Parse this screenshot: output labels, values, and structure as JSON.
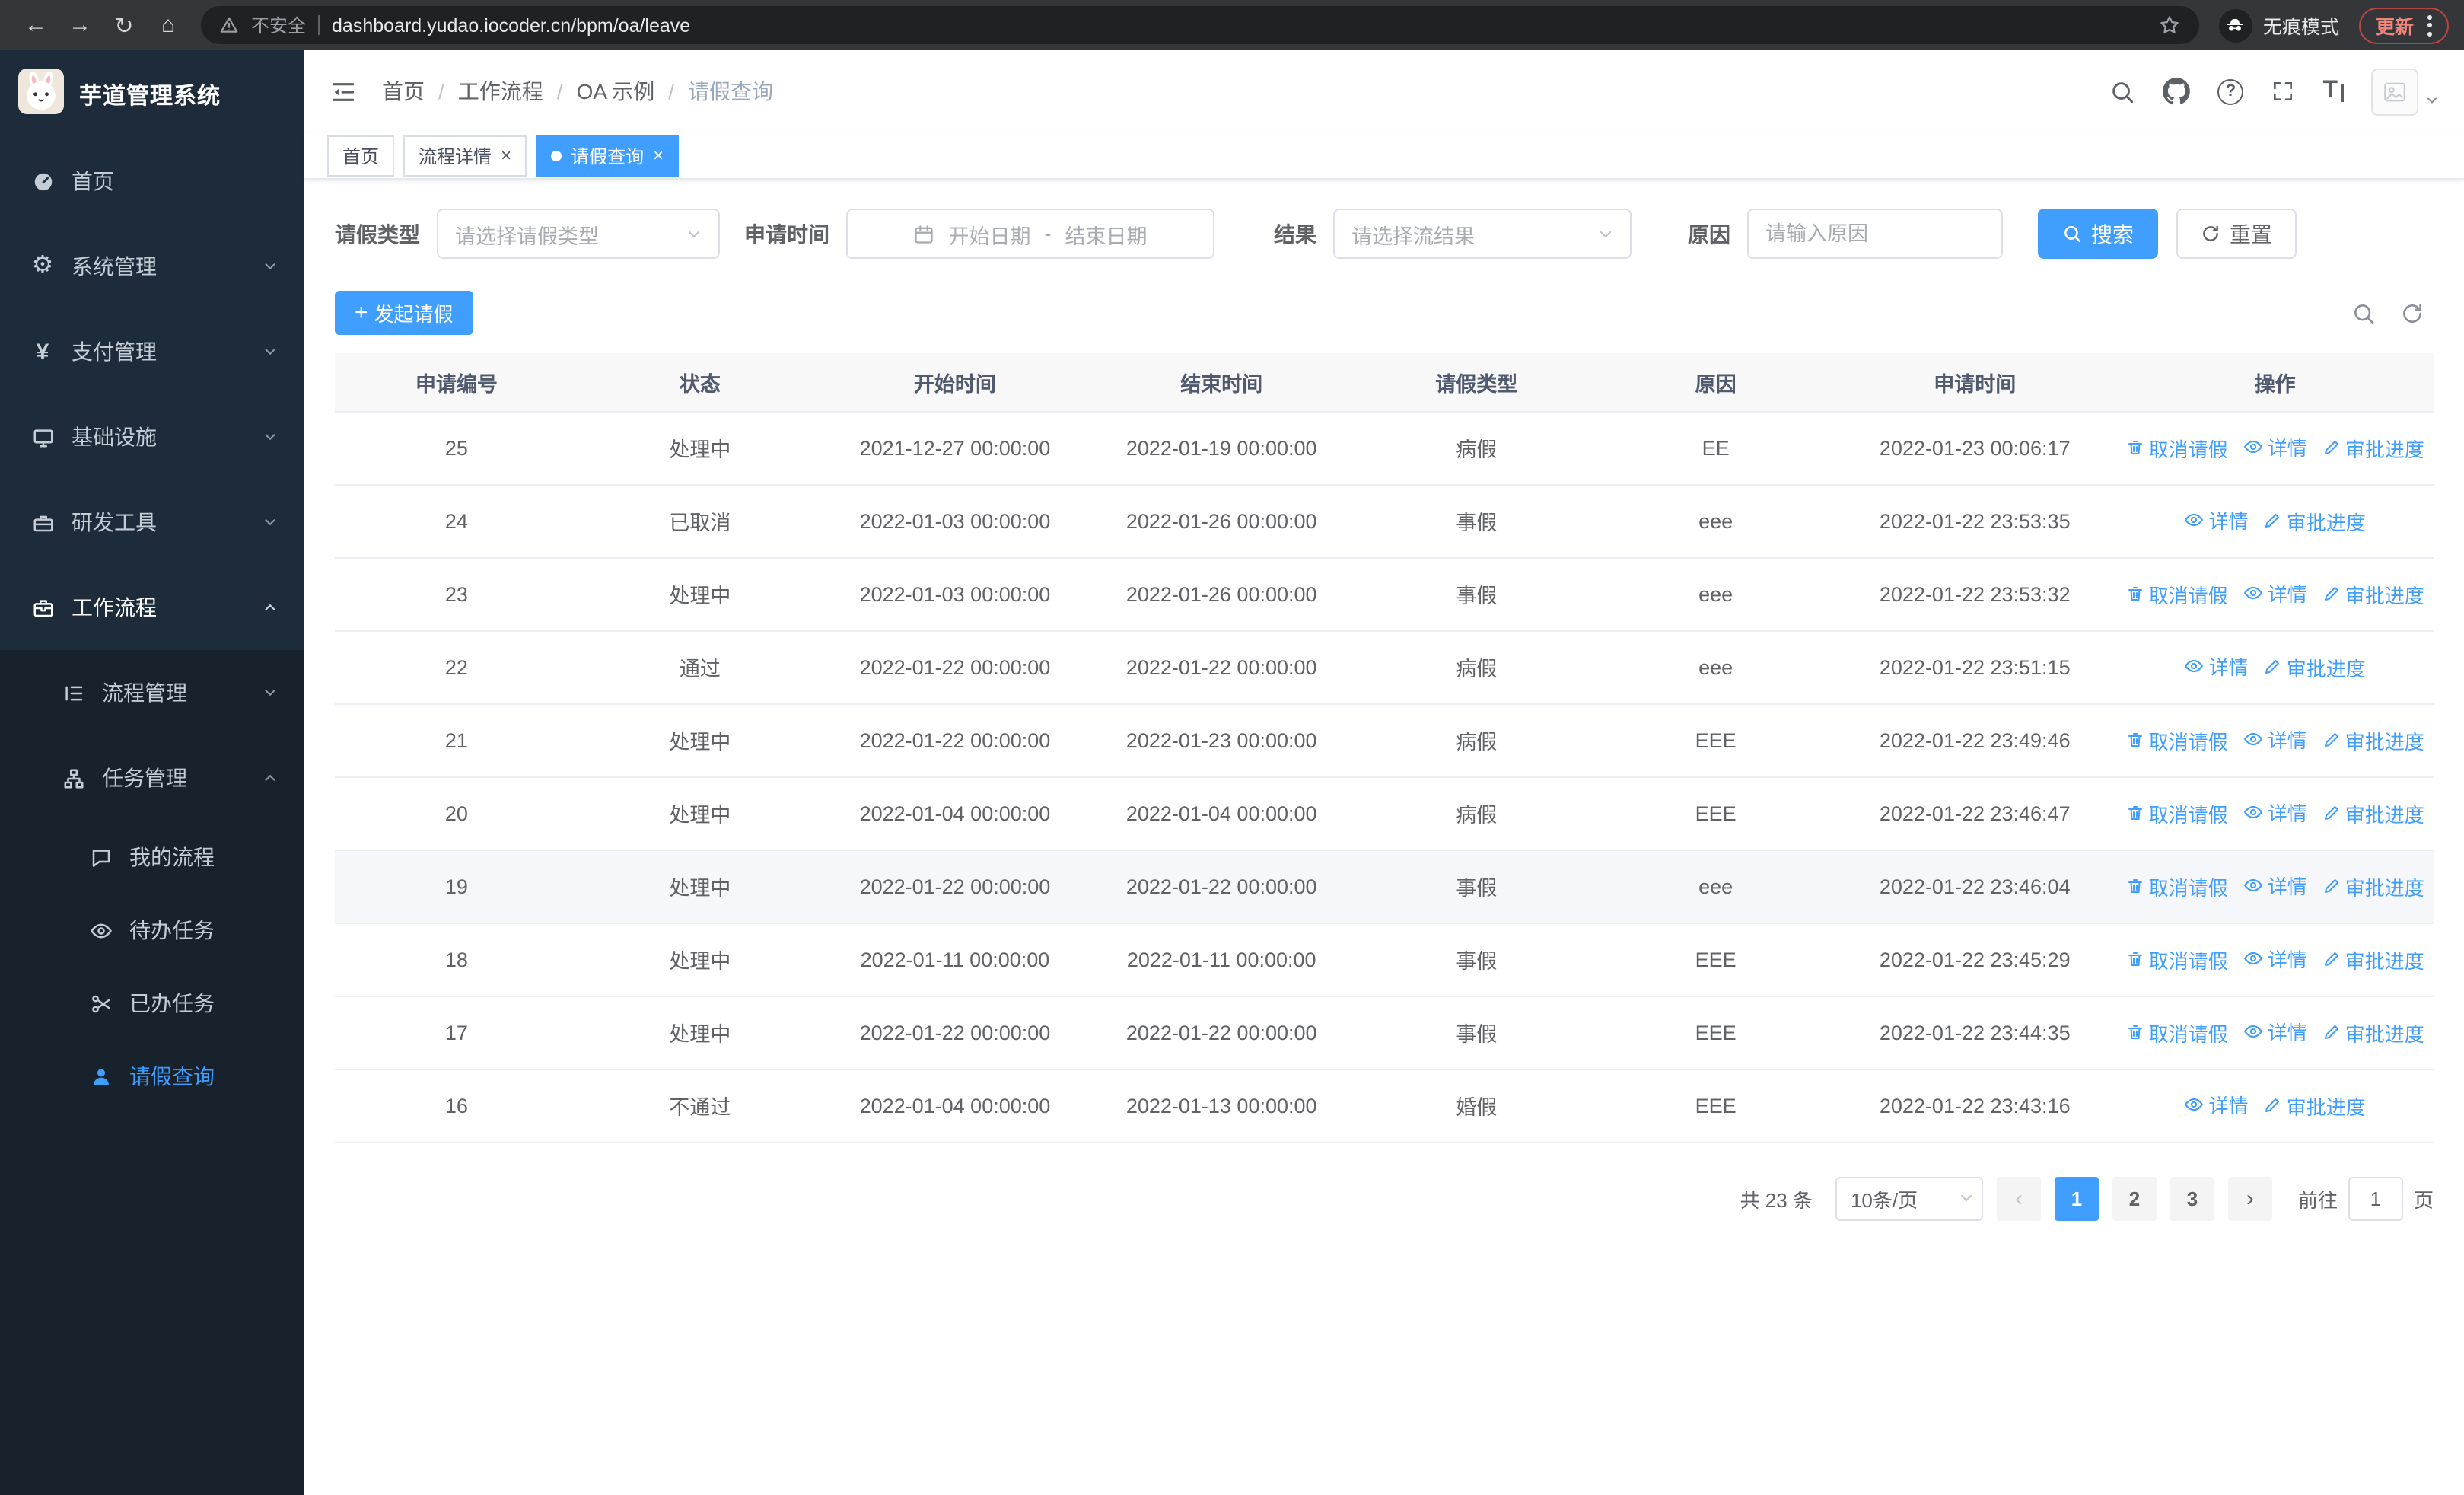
{
  "browser": {
    "security_label": "不安全",
    "url": "dashboard.yudao.iocoder.cn/bpm/oa/leave",
    "incognito_label": "无痕模式",
    "update_label": "更新"
  },
  "sidebar": {
    "logo_title": "芋道管理系统",
    "menu": [
      {
        "label": "首页"
      },
      {
        "label": "系统管理"
      },
      {
        "label": "支付管理"
      },
      {
        "label": "基础设施"
      },
      {
        "label": "研发工具"
      },
      {
        "label": "工作流程"
      }
    ],
    "submenu": [
      {
        "label": "流程管理"
      },
      {
        "label": "任务管理"
      }
    ],
    "leaf_items": [
      {
        "label": "我的流程"
      },
      {
        "label": "待办任务"
      },
      {
        "label": "已办任务"
      },
      {
        "label": "请假查询"
      }
    ]
  },
  "breadcrumb": [
    "首页",
    "工作流程",
    "OA 示例",
    "请假查询"
  ],
  "tabs": [
    {
      "label": "首页",
      "closable": false,
      "active": false
    },
    {
      "label": "流程详情",
      "closable": true,
      "active": false
    },
    {
      "label": "请假查询",
      "closable": true,
      "active": true
    }
  ],
  "filters": {
    "leave_type_label": "请假类型",
    "leave_type_placeholder": "请选择请假类型",
    "apply_time_label": "申请时间",
    "start_date_placeholder": "开始日期",
    "range_separator": "-",
    "end_date_placeholder": "结束日期",
    "result_label": "结果",
    "result_placeholder": "请选择流结果",
    "reason_label": "原因",
    "reason_placeholder": "请输入原因",
    "search_button": "搜索",
    "reset_button": "重置"
  },
  "toolbar": {
    "create_button": "发起请假"
  },
  "table": {
    "columns": [
      "申请编号",
      "状态",
      "开始时间",
      "结束时间",
      "请假类型",
      "原因",
      "申请时间",
      "操作"
    ],
    "action_labels": {
      "cancel": "取消请假",
      "detail": "详情",
      "progress": "审批进度"
    },
    "rows": [
      {
        "id": "25",
        "status": "处理中",
        "start": "2021-12-27 00:00:00",
        "end": "2022-01-19 00:00:00",
        "type": "病假",
        "reason": "EE",
        "apply_time": "2022-01-23 00:06:17",
        "actions": [
          "cancel",
          "detail",
          "progress"
        ]
      },
      {
        "id": "24",
        "status": "已取消",
        "start": "2022-01-03 00:00:00",
        "end": "2022-01-26 00:00:00",
        "type": "事假",
        "reason": "eee",
        "apply_time": "2022-01-22 23:53:35",
        "actions": [
          "detail",
          "progress"
        ]
      },
      {
        "id": "23",
        "status": "处理中",
        "start": "2022-01-03 00:00:00",
        "end": "2022-01-26 00:00:00",
        "type": "事假",
        "reason": "eee",
        "apply_time": "2022-01-22 23:53:32",
        "actions": [
          "cancel",
          "detail",
          "progress"
        ]
      },
      {
        "id": "22",
        "status": "通过",
        "start": "2022-01-22 00:00:00",
        "end": "2022-01-22 00:00:00",
        "type": "病假",
        "reason": "eee",
        "apply_time": "2022-01-22 23:51:15",
        "actions": [
          "detail",
          "progress"
        ]
      },
      {
        "id": "21",
        "status": "处理中",
        "start": "2022-01-22 00:00:00",
        "end": "2022-01-23 00:00:00",
        "type": "病假",
        "reason": "EEE",
        "apply_time": "2022-01-22 23:49:46",
        "actions": [
          "cancel",
          "detail",
          "progress"
        ]
      },
      {
        "id": "20",
        "status": "处理中",
        "start": "2022-01-04 00:00:00",
        "end": "2022-01-04 00:00:00",
        "type": "病假",
        "reason": "EEE",
        "apply_time": "2022-01-22 23:46:47",
        "actions": [
          "cancel",
          "detail",
          "progress"
        ]
      },
      {
        "id": "19",
        "status": "处理中",
        "start": "2022-01-22 00:00:00",
        "end": "2022-01-22 00:00:00",
        "type": "事假",
        "reason": "eee",
        "apply_time": "2022-01-22 23:46:04",
        "actions": [
          "cancel",
          "detail",
          "progress"
        ],
        "highlight": true
      },
      {
        "id": "18",
        "status": "处理中",
        "start": "2022-01-11 00:00:00",
        "end": "2022-01-11 00:00:00",
        "type": "事假",
        "reason": "EEE",
        "apply_time": "2022-01-22 23:45:29",
        "actions": [
          "cancel",
          "detail",
          "progress"
        ]
      },
      {
        "id": "17",
        "status": "处理中",
        "start": "2022-01-22 00:00:00",
        "end": "2022-01-22 00:00:00",
        "type": "事假",
        "reason": "EEE",
        "apply_time": "2022-01-22 23:44:35",
        "actions": [
          "cancel",
          "detail",
          "progress"
        ]
      },
      {
        "id": "16",
        "status": "不通过",
        "start": "2022-01-04 00:00:00",
        "end": "2022-01-13 00:00:00",
        "type": "婚假",
        "reason": "EEE",
        "apply_time": "2022-01-22 23:43:16",
        "actions": [
          "detail",
          "progress"
        ]
      }
    ]
  },
  "pagination": {
    "total_label": "共 23 条",
    "page_size": "10条/页",
    "pages": [
      "1",
      "2",
      "3"
    ],
    "active_page": "1",
    "goto_label": "前往",
    "goto_value": "1",
    "goto_suffix": "页"
  }
}
